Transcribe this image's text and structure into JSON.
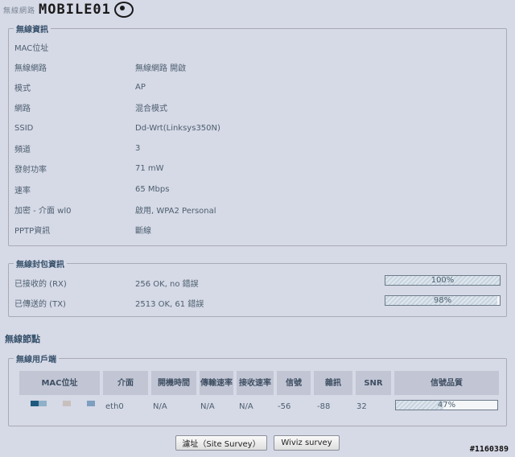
{
  "watermark": {
    "title": "無線網路",
    "logo": "MOBILE01"
  },
  "wireless_info": {
    "legend": "無線資訊",
    "rows": [
      {
        "label": "MAC位址",
        "value": ""
      },
      {
        "label": "無線網路",
        "value": "無線網路 開啟"
      },
      {
        "label": "模式",
        "value": "AP"
      },
      {
        "label": "網路",
        "value": "混合模式"
      },
      {
        "label": "SSID",
        "value": "Dd-Wrt(Linksys350N)"
      },
      {
        "label": "頻道",
        "value": "3"
      },
      {
        "label": "發射功率",
        "value": "71 mW"
      },
      {
        "label": "速率",
        "value": "65 Mbps"
      },
      {
        "label": "加密 - 介面 wl0",
        "value": "啟用, WPA2 Personal"
      },
      {
        "label": "PPTP資訊",
        "value": "斷線"
      }
    ]
  },
  "packet_info": {
    "legend": "無線封包資訊",
    "rx": {
      "label": "已接收的 (RX)",
      "value": "256 OK, no 錯誤",
      "percent_text": "100%",
      "percent": 100
    },
    "tx": {
      "label": "已傳送的 (TX)",
      "value": "2513 OK, 61 錯誤",
      "percent_text": "98%",
      "percent": 98
    }
  },
  "nodes_title": "無線節點",
  "clients": {
    "legend": "無線用戶端",
    "headers": [
      "MAC位址",
      "介面",
      "開機時間",
      "傳輸速率",
      "接收速率",
      "信號",
      "雜訊",
      "SNR",
      "信號品質"
    ],
    "row": {
      "interface": "eth0",
      "uptime": "N/A",
      "tx_rate": "N/A",
      "rx_rate": "N/A",
      "signal": "-56",
      "noise": "-88",
      "snr": "32",
      "quality_text": "47%",
      "quality": 47
    },
    "mac_colors": [
      "#1f5a7e",
      "#8fb0c9",
      "#c7c0bd",
      "#7e9fbf"
    ]
  },
  "buttons": {
    "site_survey": "濾址（Site Survey）",
    "wiviz": "Wiviz survey"
  },
  "ref_number": "#1160389",
  "colors": {
    "background": "#d6d9e6",
    "header_bg": "#c2c6d4",
    "text": "#4c5f6f"
  }
}
